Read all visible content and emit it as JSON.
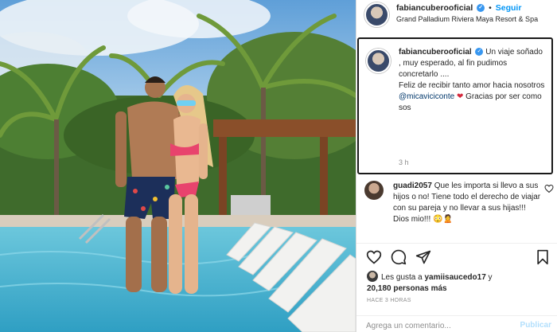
{
  "post": {
    "username": "fabiancuberooficial",
    "follow_label": "Seguir",
    "separator": "•",
    "location": "Grand Palladium Riviera Maya Resort & Spa",
    "verified_icon": "verified-badge-icon"
  },
  "caption": {
    "username": "fabiancuberooficial",
    "text_part1": "Un viaje soñado , muy esperado, al fin pudimos concretarlo ....\nFeliz de recibir tanto amor hacia nosotros ",
    "mention": "@micaviciconte",
    "text_part2": " Gracias por ser como sos",
    "time": "3 h"
  },
  "comment": {
    "username": "guadi2057",
    "text": "Que les importa si llevo a sus hijos o no! Tiene todo el derecho de viajar con su pareja y no llevar a sus hijas!!! Dios mio!!! 😳🙎"
  },
  "likes": {
    "prefix": "Les gusta a ",
    "liker": "yamiisaucedo17",
    "connector": " y",
    "count": "20,180 personas más"
  },
  "timeago": "HACE 3 HORAS",
  "comment_bar": {
    "placeholder": "Agrega un comentario...",
    "publish_label": "Publicar"
  },
  "colors": {
    "link_blue": "#0095f6",
    "mention_blue": "#00376b",
    "muted_gray": "#8e8e8e",
    "publish_disabled": "#b2dffc",
    "heart_red": "#d4283c"
  }
}
